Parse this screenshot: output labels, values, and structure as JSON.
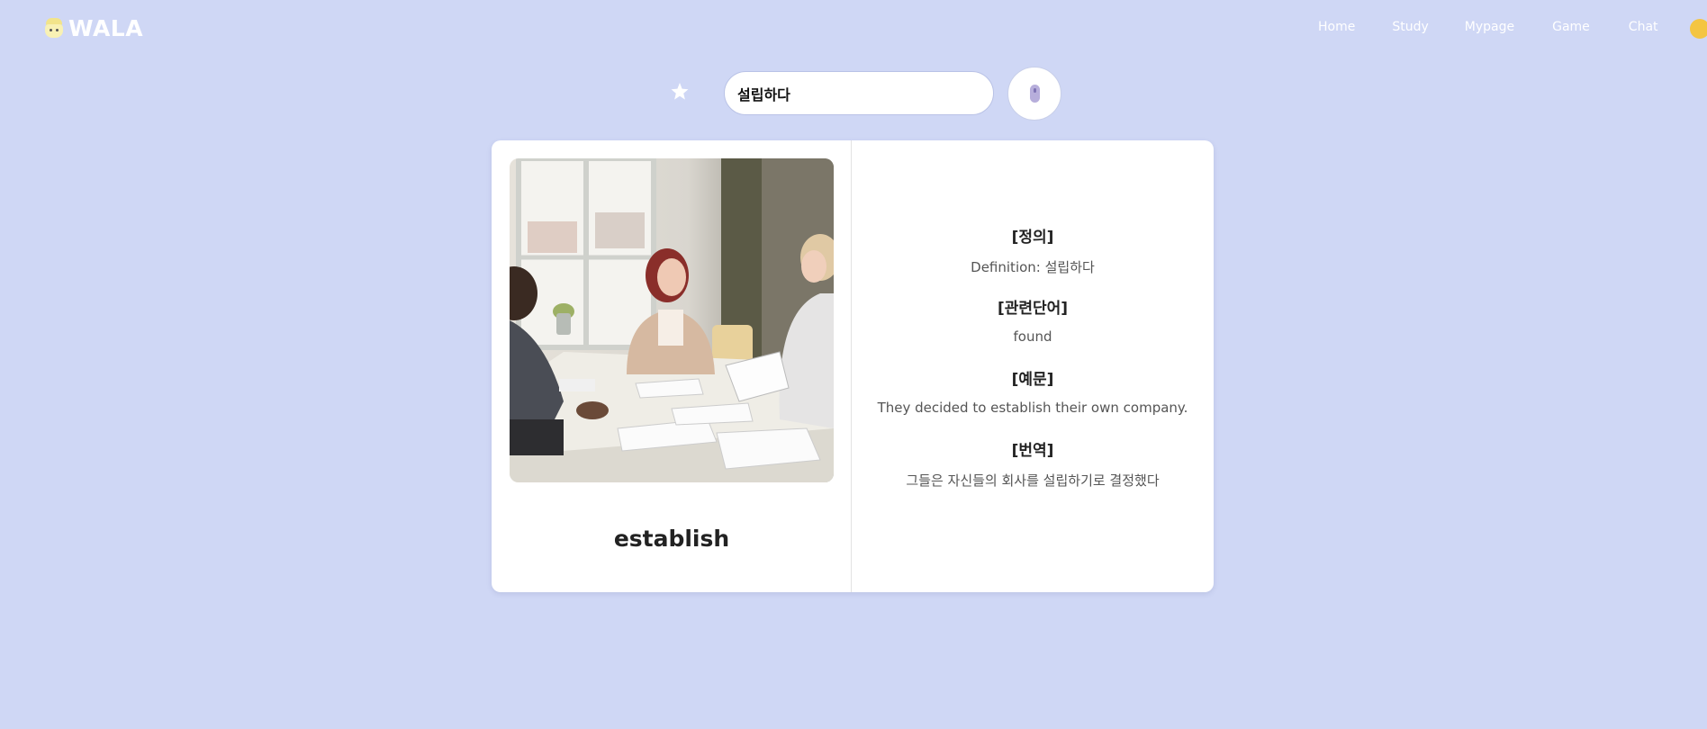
{
  "header": {
    "brand": "WALA",
    "nav": [
      "Home",
      "Study",
      "Mypage",
      "Game",
      "Chat"
    ]
  },
  "search": {
    "value": "설립하다"
  },
  "icons": {
    "favorite": "star-icon",
    "voice": "microphone-icon",
    "logo": "mascot-icon"
  },
  "card": {
    "word": "establish",
    "definition_heading": "[정의]",
    "definition": "Definition: 설립하다",
    "related_heading": "[관련단어]",
    "related": "found",
    "example_heading": "[예문]",
    "example": "They decided to establish their own company.",
    "translation_heading": "[번역]",
    "translation": "그들은 자신들의 회사를 설립하기로 결정했다"
  },
  "colors": {
    "background": "#cfd7f5",
    "card": "#ffffff",
    "text": "#222222"
  }
}
